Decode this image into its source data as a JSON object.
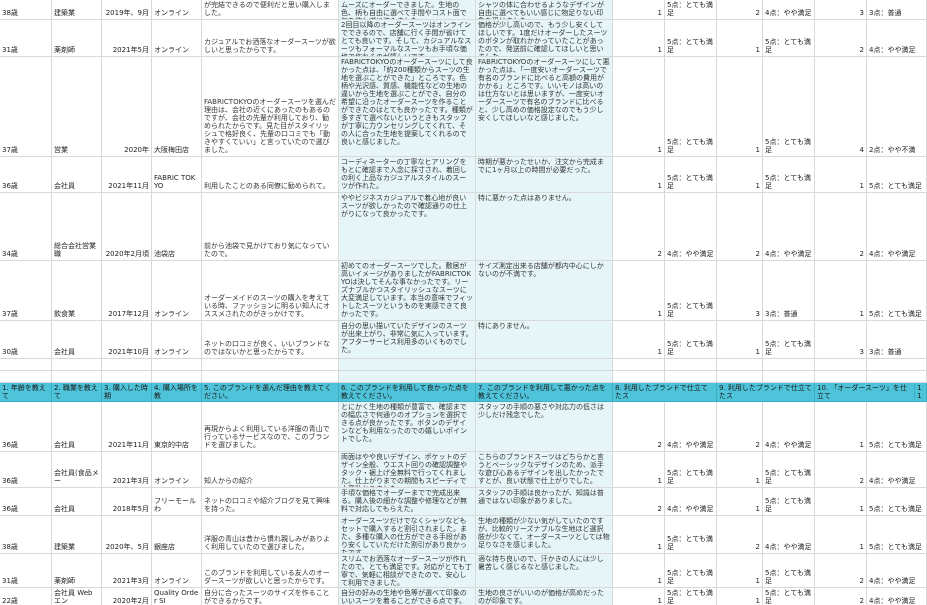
{
  "header": {
    "c1": "1. 年齢を教えて",
    "c2": "2. 職業を教えて",
    "c3": "3. 購入した時期",
    "c4": "4. 購入場所を教",
    "c5": "5. このブランドを選んだ理由を教えてください。",
    "c6": "6. このブランドを利用して良かった点を教えてください。",
    "c7": "7. このブランドを利用して悪かった点を教えてください。",
    "c8": "8. 利用したブランドで仕立てたス",
    "c9": "9. 利用したブランドで仕立てたス",
    "c10": "10. 「オーダースーツ」を仕立て",
    "c11": "11"
  },
  "top_rows": [
    {
      "age": "38歳",
      "job": "建築業",
      "date": "2019年、9月",
      "place": "オンライン",
      "reason": "以前の購入時にサイズを測っていてもらっていたので、後はオンラインでオーダーが完結できるので便利だと思い購入しました。",
      "good": "ムーズにオーダーできました。生地の色、柄も自由に選べて手間やコスト面で気を使わずに済みました。",
      "bad": "シャツの体に合わせるようなデザインが自由に選べてもいい感じに物足りない印象を受けました。",
      "q8": "1",
      "q8t": "5点：とても満足",
      "q9": "2",
      "q9t": "4点：やや満足",
      "q10": "3",
      "q10t": "3点：普通"
    },
    {
      "age": "31歳",
      "job": "薬剤師",
      "date": "2021年5月",
      "place": "オンライン",
      "reason": "カジュアルでお洒落なオーダースーツが欲しいと思ったからです。",
      "good": "2回目以降のオーダースーツはオンラインでできるので、店舗に行く手間が省けてとても良いです。そして、カジュアルなスーツもフォーマルなスーツもお手頃な価格で作れるのが嬉しいです。",
      "bad": "価格が少し高いので、もう少し安くしてほしいです。1度だけオーダーしたスーツのボタンが取れかかっていたことがあったので、発送前に確認してほしいと思いました。",
      "q8": "1",
      "q8t": "5点：とても満足",
      "q9": "1",
      "q9t": "5点：とても満足",
      "q10": "2",
      "q10t": "4点：やや満足"
    },
    {
      "age": "37歳",
      "job": "営業",
      "date": "2020年",
      "place": "大阪梅田店",
      "reason": "FABRICTOKYOのオーダースーツを選んだ理由は、会社の近くにあったのもあるのですが、会社の先輩が利用しており、勧められたからです。見た目がスタイリッシュで格好良く、先輩の口コミでも「動きやすくていい」と言っていたので選びました。",
      "good": "FABRICTOKYOのオーダースーツにして良かった点は、「約200種類からスーツの生地を選ぶことができた」ところです。色柄や光沢感、質感、機能性などの生地の違いから生地を選ぶことができ、自分の希望に沿ったオーダースーツを作ることができたのはとても良かったです。種類が多すぎて選べないというときもスタッフが丁寧に力ウンセリングしてくれて、その人に合った生地を提案してくれるので良いと感じました。",
      "bad": "FABRICTOKYOのオーダースーツにして悪かった点は、「一度安いオーダースーツで有名のブランドに比べると高額の費用がかかる」ところです。いいモノは高いのは仕方ないとは思いますが、一度安いオーダースーツで有名のブランドに比べると、少し高めの価格設定なのでもう少し安くしてほしいなと感じました。",
      "q8": "1",
      "q8t": "5点：とても満足",
      "q9": "1",
      "q9t": "5点：とても満足",
      "q10": "4",
      "q10t": "2点：やや不満"
    },
    {
      "age": "36歳",
      "job": "会社員",
      "date": "2021年11月",
      "place": "FABRIC TOKYO",
      "reason": "利用したことのある同僚に勧められて。",
      "good": "コーディネーターの丁寧なヒアリングをもとに確認まで入念に採寸され、着回しの利く上品なカジュアルスタイルのスーツが作れた。",
      "bad": "時期が悪かったせいか、注文から完成までに1ヶ月以上の時間が必要だった。",
      "q8": "1",
      "q8t": "5点：とても満足",
      "q9": "1",
      "q9t": "5点：とても満足",
      "q10": "1",
      "q10t": "5点：とても満足"
    },
    {
      "age": "34歳",
      "job": "総合会社営業職",
      "date": "2020年2月頃",
      "place": "池袋店",
      "reason": "前から池袋で見かけており気になっていたので。",
      "good": "ややビジネスカジュアルで着心地が良いスーツが欲しかったので確認通りの仕上がりになって良かったです。",
      "bad": "特に悪かった点はありません。",
      "q8": "2",
      "q8t": "4点：やや満足",
      "q9": "2",
      "q9t": "4点：やや満足",
      "q10": "2",
      "q10t": "4点：やや満足"
    },
    {
      "age": "37歳",
      "job": "飲食業",
      "date": "2017年12月",
      "place": "オンライン",
      "reason": "オーダーメイドのスーツの購入を考えている時、ファッションに明るい知人にオススメされたのがきっかけです。",
      "good": "初めてのオーダースーツでした。敷居が高いイメージがありましたがFABRICTOKYOは決してそんな事なかったです。リーズナブルかつスタイリッシュなスーツに大変満足しています。本当の意味でフィットしたスーツというものを実感できて良かったです。",
      "bad": "サイズ測定出来る店舗が都内中心にしかないのが不満です。",
      "q8": "1",
      "q8t": "5点：とても満足",
      "q9": "3",
      "q9t": "3点：普通",
      "q10": "1",
      "q10t": "5点：とても満足"
    },
    {
      "age": "30歳",
      "job": "会社員",
      "date": "2021年10月",
      "place": "オンライン",
      "reason": "ネットの口コミが良く、いいブランドなのではないかと思ったからです。",
      "good": "自分の思い描いていたデザインのスーツが出来上がり、非常に気に入っています。アフターサービス利用多のいくものでした。",
      "bad": "特にありません。",
      "q8": "1",
      "q8t": "5点：とても満足",
      "q9": "1",
      "q9t": "5点：とても満足",
      "q10": "3",
      "q10t": "3点：普通"
    }
  ],
  "bottom_rows": [
    {
      "age": "36歳",
      "job": "会社員",
      "date": "2021年11月",
      "place": "東京的中店",
      "reason": "再現からよく利用している洋服の青山で行っているサービスなので、このブランドを選びました。",
      "good": "とにかく生地の種類が豊富で、確認までの幅広さで何通りのオプションを選択できる点が良かったです。ボタンのデザインなども利用なったのでの嬉しいポイントでした。",
      "bad": "スタッフの手順の悪さや対応力の低さは少しだけ残念でした。",
      "q8": "2",
      "q8t": "4点：やや満足",
      "q9": "2",
      "q9t": "4点：やや満足",
      "q10": "1",
      "q10t": "5点：とても満足"
    },
    {
      "age": "36歳",
      "job": "会社員(食品メー",
      "date": "2021年3月",
      "place": "オンライン",
      "reason": "知人からの紹介",
      "good": "両面はやや良いデザイン、ポケットのデザイン全般、ウエスト回りの確認調整やタック・裾上げ全無料で行ってくれました。仕上がりまでの期間もスピーディで大変助かりました。",
      "bad": "こちらのブランドスーツはどちらかと言うとベーシックなデザインのため、派手な遊び心あるデザインを出したかったですとが、良い状態で仕上がりでした。",
      "q8": "1",
      "q8t": "5点：とても満足",
      "q9": "1",
      "q9t": "5点：とても満足",
      "q10": "2",
      "q10t": "4点：やや満足"
    },
    {
      "age": "36歳",
      "job": "会社員",
      "date": "2018年5月",
      "place": "フリーモールわ",
      "reason": "ネットの口コミや紹介ブログを見て興味を持った。",
      "good": "手頃な価格でオーダーまでで完成出来る。購入後の細かな調整や修理などが無料で対応してもらえた。",
      "bad": "スタッフの手順は良かったが、知識は普通ではない印象がありました。",
      "q8": "2",
      "q8t": "4点：やや満足",
      "q9": "1",
      "q9t": "5点：とても満足",
      "q10": "1",
      "q10t": "5点：とても満足"
    },
    {
      "age": "38歳",
      "job": "建築業",
      "date": "2020年、5月",
      "place": "銀座店",
      "reason": "洋服の青山は昔から慣れ親しみがありよく利用していたので選びました。",
      "good": "オーダースーツだけでなくシャツなどもセットで購入すると割引されました。また、多種な購入の仕方ができる手段があり安くしていただけた割引があり良かったです。",
      "bad": "生地の種類が少ない気がしていたのですが、比較的リーズナブルな生地ほど選択肢が少なくて、オーダースーツとしては物足りなさを感じました。",
      "q8": "1",
      "q8t": "5点：とても満足",
      "q9": "2",
      "q9t": "4点：やや満足",
      "q10": "1",
      "q10t": "5点：とても満足"
    },
    {
      "age": "31歳",
      "job": "薬剤師",
      "date": "2021年3月",
      "place": "オンライン",
      "reason": "このブランドを利用している友人のオーダースーツが欲しいと思ったからです。",
      "good": "スリムでお洒落なオーダースーツが作れたので、とても満足です。対応がとても丁寧で、気軽に相談ができたので、安心して利用できました。",
      "bad": "適な持ち良いので、汗かきの人には少し暑苦しく感じるなと感じました。",
      "q8": "1",
      "q8t": "5点：とても満足",
      "q9": "1",
      "q9t": "5点：とても満足",
      "q10": "2",
      "q10t": "4点：やや満足"
    },
    {
      "age": "22歳",
      "job": "会社員 Webエン",
      "date": "2020年2月",
      "place": "Quality Order SI",
      "reason": "自分に合ったスーツのサイズを作ることができるからです。",
      "good": "自分の好みの生地や色等が選べて印象のいいスーツを着ることができる点です。",
      "bad": "生地の良さがいいのが価格が高めだったのが印象です。",
      "q8": "1",
      "q8t": "5点：とても満足",
      "q9": "1",
      "q9t": "5点：とても満足",
      "q10": "2",
      "q10t": "4点：やや満足"
    }
  ]
}
